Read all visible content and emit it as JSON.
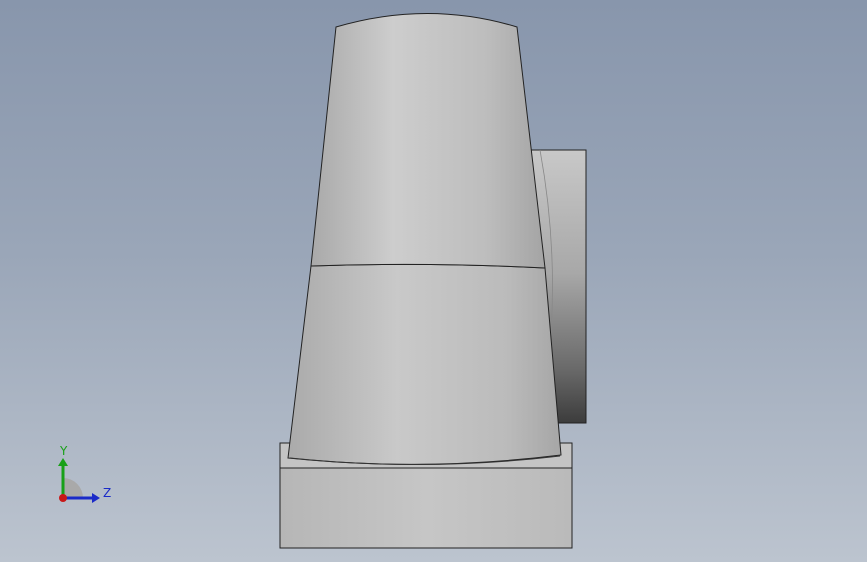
{
  "viewport": {
    "background_top": "#8896ac",
    "background_bottom": "#bcc4cf"
  },
  "model": {
    "body_color": "#bdbdbd",
    "base_color": "#c2c2c2",
    "edge_color": "#222222",
    "shaft_color": "#8a8a8a"
  },
  "triad": {
    "y_label": "Y",
    "z_label": "Z",
    "y_color": "#18a018",
    "z_color": "#1a2ac8",
    "x_color": "#c81818"
  }
}
